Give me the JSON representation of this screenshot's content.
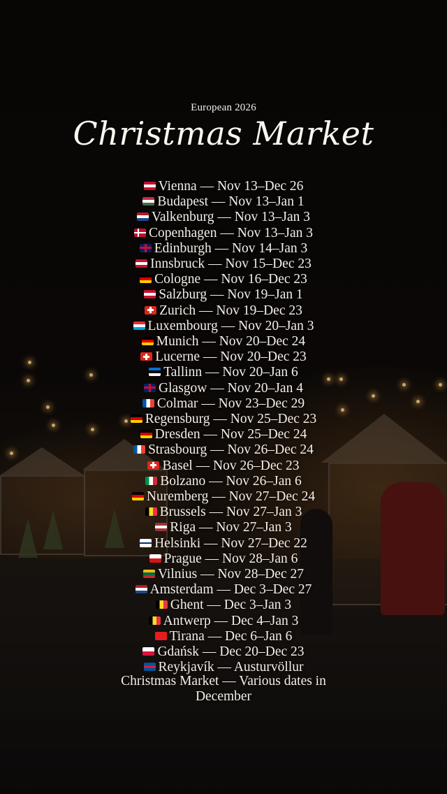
{
  "header": {
    "subtitle": "European 2026",
    "title": "Christmas Market"
  },
  "markets": [
    {
      "flag": "austria-flag",
      "flag_colors": [
        "#c8102e",
        "#ffffff",
        "#c8102e"
      ],
      "text": "Vienna — Nov 13–Dec 26"
    },
    {
      "flag": "hungary-flag",
      "flag_colors": [
        "#cd2a3e",
        "#ffffff",
        "#436f4d"
      ],
      "text": "Budapest — Nov 13–Jan 1"
    },
    {
      "flag": "netherlands-flag",
      "flag_colors": [
        "#ae1c28",
        "#ffffff",
        "#21468b"
      ],
      "text": "Valkenburg — Nov 13–Jan 3"
    },
    {
      "flag": "denmark-flag",
      "flag_colors": [
        "#c60c30",
        "#ffffff"
      ],
      "text": "Copenhagen — Nov 13–Jan 3"
    },
    {
      "flag": "uk-flag",
      "flag_colors": [
        "#012169",
        "#c8102e",
        "#ffffff"
      ],
      "text": "Edinburgh — Nov 14–Jan 3"
    },
    {
      "flag": "austria-flag",
      "flag_colors": [
        "#c8102e",
        "#ffffff",
        "#c8102e"
      ],
      "text": "Innsbruck — Nov 15–Dec 23"
    },
    {
      "flag": "germany-flag",
      "flag_colors": [
        "#000000",
        "#dd0000",
        "#ffce00"
      ],
      "text": "Cologne — Nov 16–Dec 23"
    },
    {
      "flag": "austria-flag",
      "flag_colors": [
        "#c8102e",
        "#ffffff",
        "#c8102e"
      ],
      "text": "Salzburg — Nov 19–Jan 1"
    },
    {
      "flag": "switzerland-flag",
      "flag_colors": [
        "#da291c",
        "#ffffff"
      ],
      "text": "Zurich — Nov 19–Dec 23"
    },
    {
      "flag": "luxembourg-flag",
      "flag_colors": [
        "#ed2939",
        "#ffffff",
        "#00a1de"
      ],
      "text": "Luxembourg — Nov 20–Jan 3"
    },
    {
      "flag": "germany-flag",
      "flag_colors": [
        "#000000",
        "#dd0000",
        "#ffce00"
      ],
      "text": "Munich — Nov 20–Dec 24"
    },
    {
      "flag": "switzerland-flag",
      "flag_colors": [
        "#da291c",
        "#ffffff"
      ],
      "text": "Lucerne — Nov 20–Dec 23"
    },
    {
      "flag": "estonia-flag",
      "flag_colors": [
        "#0072ce",
        "#000000",
        "#ffffff"
      ],
      "text": "Tallinn — Nov 20–Jan 6"
    },
    {
      "flag": "uk-flag",
      "flag_colors": [
        "#012169",
        "#c8102e",
        "#ffffff"
      ],
      "text": "Glasgow — Nov 20–Jan 4"
    },
    {
      "flag": "france-flag",
      "flag_colors": [
        "#0055a4",
        "#ffffff",
        "#ef4135"
      ],
      "text": "Colmar — Nov 23–Dec 29"
    },
    {
      "flag": "germany-flag",
      "flag_colors": [
        "#000000",
        "#dd0000",
        "#ffce00"
      ],
      "text": "Regensburg — Nov 25–Dec 23"
    },
    {
      "flag": "germany-flag",
      "flag_colors": [
        "#000000",
        "#dd0000",
        "#ffce00"
      ],
      "text": "Dresden — Nov 25–Dec 24"
    },
    {
      "flag": "france-flag",
      "flag_colors": [
        "#0055a4",
        "#ffffff",
        "#ef4135"
      ],
      "text": "Strasbourg — Nov 26–Dec 24"
    },
    {
      "flag": "switzerland-flag",
      "flag_colors": [
        "#da291c",
        "#ffffff"
      ],
      "text": "Basel — Nov 26–Dec 23"
    },
    {
      "flag": "italy-flag",
      "flag_colors": [
        "#009246",
        "#ffffff",
        "#ce2b37"
      ],
      "text": "Bolzano — Nov 26–Jan 6"
    },
    {
      "flag": "germany-flag",
      "flag_colors": [
        "#000000",
        "#dd0000",
        "#ffce00"
      ],
      "text": "Nuremberg — Nov 27–Dec 24"
    },
    {
      "flag": "belgium-flag",
      "flag_colors": [
        "#000000",
        "#fdda24",
        "#ef3340"
      ],
      "text": "Brussels — Nov 27–Jan 3"
    },
    {
      "flag": "latvia-flag",
      "flag_colors": [
        "#9e3039",
        "#ffffff",
        "#9e3039"
      ],
      "text": "Riga — Nov 27–Jan 3"
    },
    {
      "flag": "finland-flag",
      "flag_colors": [
        "#ffffff",
        "#002f6c"
      ],
      "text": "Helsinki — Nov 27–Dec 22"
    },
    {
      "flag": "czech-flag",
      "flag_colors": [
        "#ffffff",
        "#d7141a",
        "#11457e"
      ],
      "text": "Prague — Nov 28–Jan 6"
    },
    {
      "flag": "lithuania-flag",
      "flag_colors": [
        "#fdb913",
        "#006a44",
        "#c1272d"
      ],
      "text": "Vilnius — Nov 28–Dec 27"
    },
    {
      "flag": "netherlands-flag",
      "flag_colors": [
        "#ae1c28",
        "#ffffff",
        "#21468b"
      ],
      "text": "Amsterdam — Dec 3–Dec 27"
    },
    {
      "flag": "belgium-flag",
      "flag_colors": [
        "#000000",
        "#fdda24",
        "#ef3340"
      ],
      "text": "Ghent — Dec 3–Jan 3"
    },
    {
      "flag": "belgium-flag",
      "flag_colors": [
        "#000000",
        "#fdda24",
        "#ef3340"
      ],
      "text": "Antwerp — Dec 4–Jan 3"
    },
    {
      "flag": "albania-flag",
      "flag_colors": [
        "#e41e20",
        "#000000"
      ],
      "text": "Tirana — Dec 6–Jan 6"
    },
    {
      "flag": "poland-flag",
      "flag_colors": [
        "#ffffff",
        "#dc143c"
      ],
      "text": "Gdańsk — Dec 20–Dec 23"
    },
    {
      "flag": "iceland-flag",
      "flag_colors": [
        "#02529c",
        "#ffffff",
        "#dc1e35"
      ],
      "text": "Reykjavík — Austurvöllur"
    }
  ],
  "footer": {
    "text": "Christmas Market — Various dates in December"
  }
}
